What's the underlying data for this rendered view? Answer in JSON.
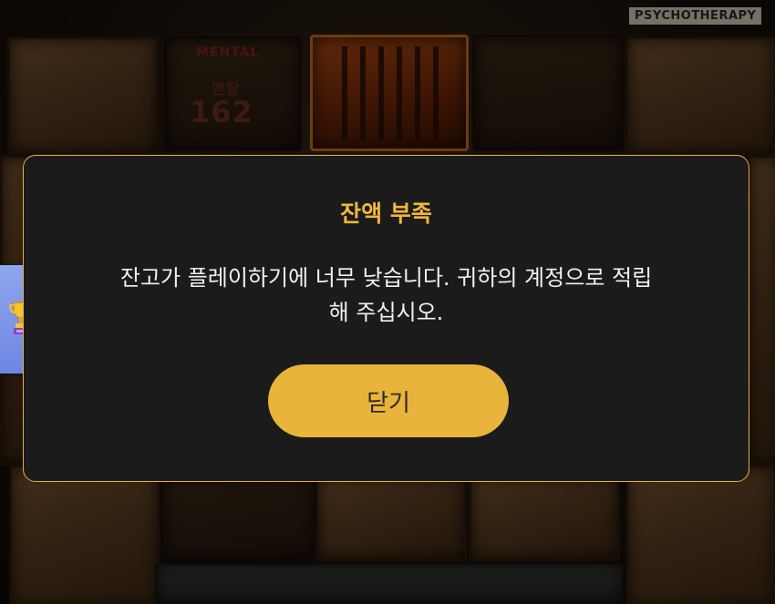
{
  "background": {
    "psychotherapy_label": "PSYCHOTHERAPY",
    "mental_label": "MENTAL",
    "mental_sub": "멘탈",
    "mental_value": "162"
  },
  "side_tab": {
    "icon": "trophy-icon"
  },
  "dialog": {
    "title": "잔액 부족",
    "message": "잔고가 플레이하기에 너무 낮습니다. 귀하의 계정으로 적립\n해 주십시오.",
    "close_label": "닫기",
    "accent_color": "#e8b43c"
  }
}
